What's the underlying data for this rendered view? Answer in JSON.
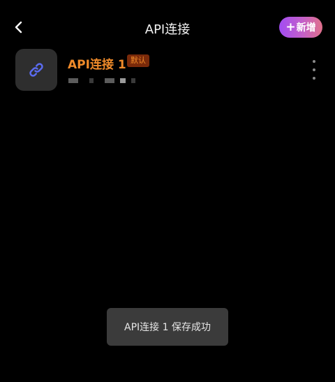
{
  "header": {
    "title": "API连接",
    "add_label": "新增",
    "add_plus": "+",
    "back_icon": "chevron-left-icon"
  },
  "connection": {
    "name": "API连接 1",
    "badge": "默认",
    "icon": "link-icon",
    "menu_icon": "more-vertical-icon"
  },
  "toast": {
    "message": "API连接 1 保存成功"
  },
  "colors": {
    "background": "#000000",
    "accent_orange": "#f08b2a",
    "badge_bg": "#7a2a0a",
    "link_icon": "#5b6cf0",
    "add_gradient_start": "#a24cf3",
    "add_gradient_end": "#e0708a"
  }
}
